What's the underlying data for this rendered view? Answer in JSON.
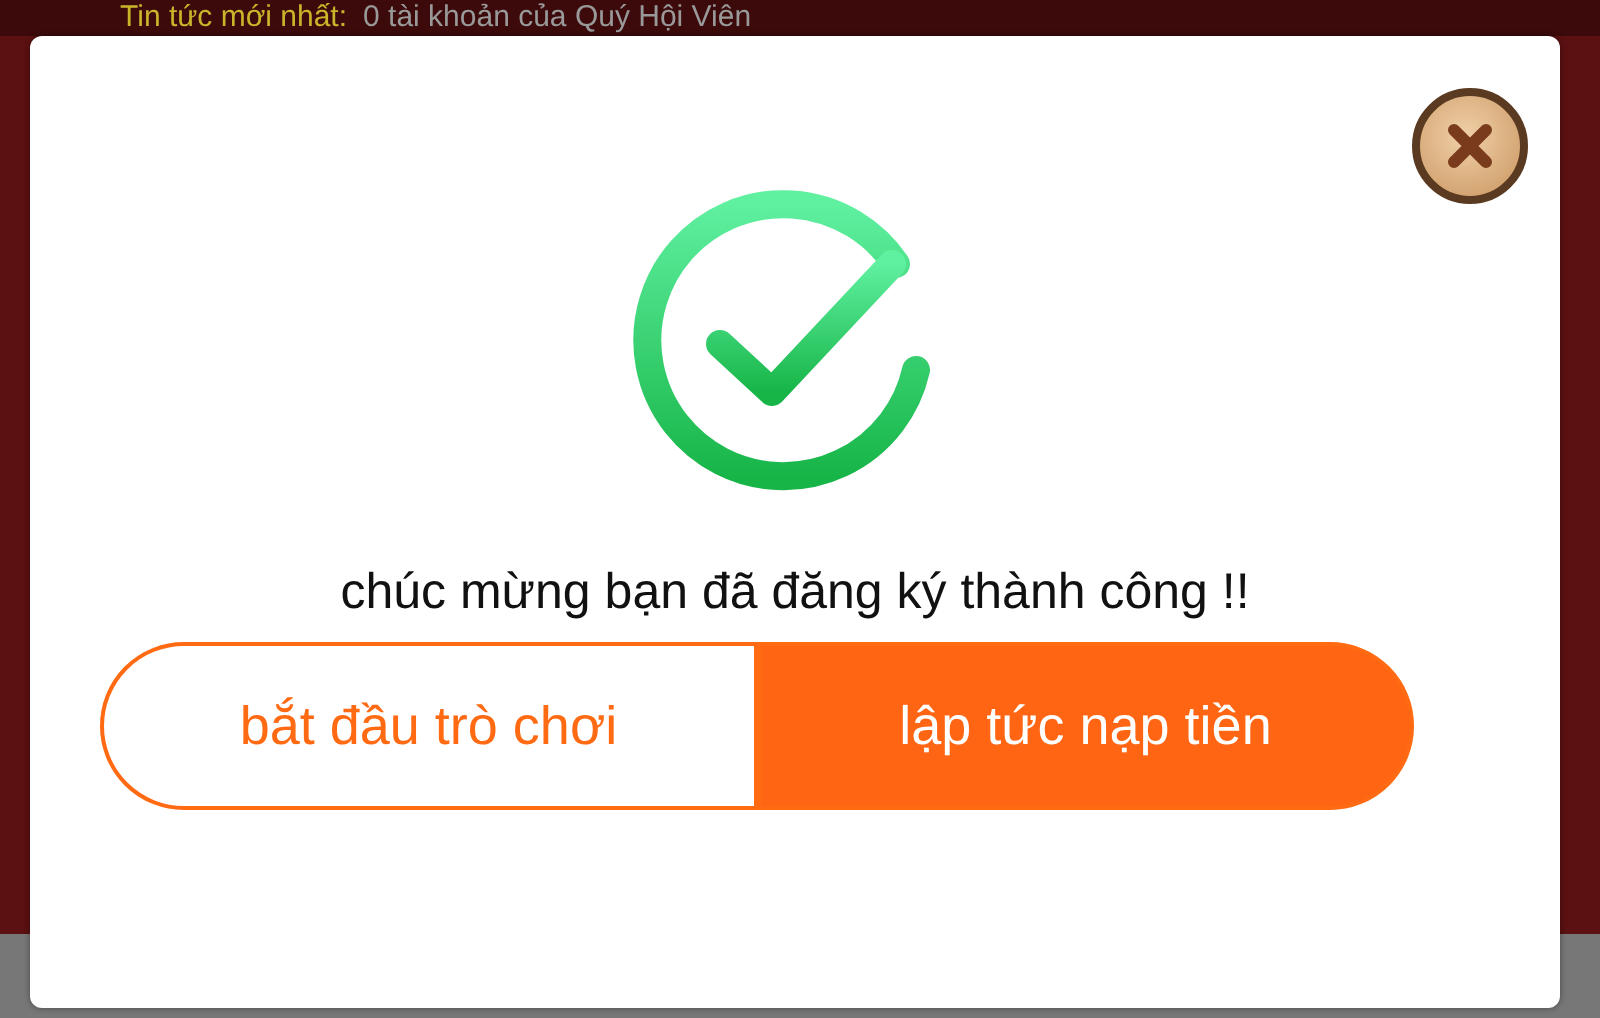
{
  "news_bar": {
    "label": "Tin tức mới nhất:",
    "text": "0 tài khoản của Quý Hội Viên"
  },
  "dialog": {
    "message": "chúc mừng bạn đã đăng ký thành công !!",
    "buttons": [
      {
        "label": "bắt đầu trò chơi",
        "kind": "outline"
      },
      {
        "label": "lập tức nạp tiền",
        "kind": "filled"
      }
    ]
  }
}
